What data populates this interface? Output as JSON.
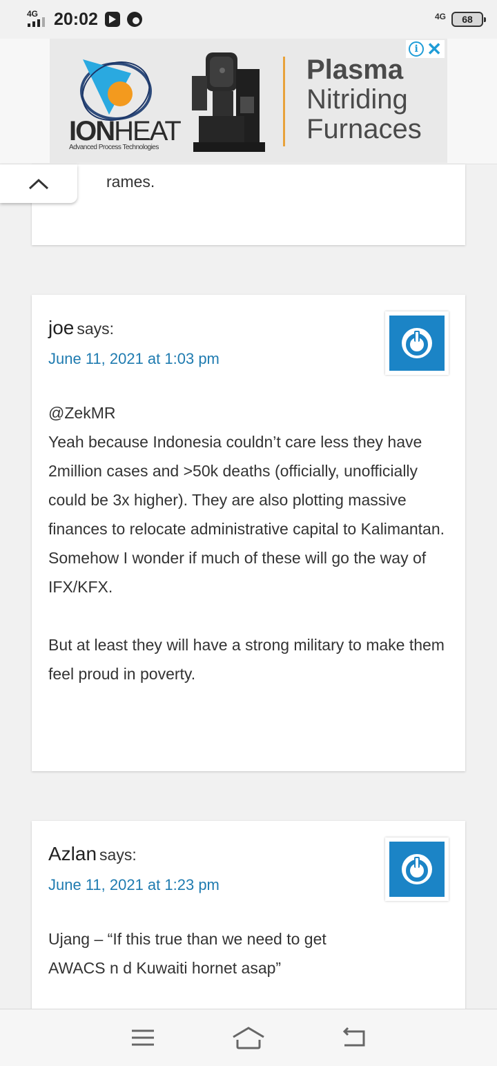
{
  "status_bar": {
    "network_left": "4G",
    "time": "20:02",
    "network_right": "4G",
    "battery": "68"
  },
  "ad": {
    "brand_bold": "ION",
    "brand_light": "HEAT",
    "tagline": "Advanced Process Technologies",
    "headline_line1": "Plasma",
    "headline_line2": "Nitriding",
    "headline_line3": "Furnaces",
    "accent_color": "#e8a23b",
    "info_icon": "i",
    "close_icon": "✕"
  },
  "collapse_tab": {
    "icon": "chevron-up-icon"
  },
  "comments": [
    {
      "fragment": "rames."
    },
    {
      "author": "joe",
      "says": "says:",
      "date": "June 11, 2021 at 1:03 pm",
      "paragraphs": [
        "@ZekMR\nYeah because Indonesia couldn’t care less they have 2million cases and >50k deaths (officially, unofficially could be 3x higher). They are also plotting massive finances to relocate administrative capital to Kalimantan. Somehow I wonder if much of these will go the way of IFX/KFX.",
        "But at least they will have a strong military to make them feel proud in poverty."
      ]
    },
    {
      "author": "Azlan",
      "says": "says:",
      "date": "June 11, 2021 at 1:23 pm",
      "paragraphs": [
        "Ujang – “If this true than we need to get AWACS n d Kuwaiti hornet asap”"
      ]
    }
  ],
  "colors": {
    "link": "#1f7bb0",
    "avatar_bg": "#1b84c6",
    "page_bg": "#f1f1f1"
  },
  "nav_bar": {
    "menu_icon": "menu-icon",
    "home_icon": "home-icon",
    "back_icon": "back-icon"
  }
}
